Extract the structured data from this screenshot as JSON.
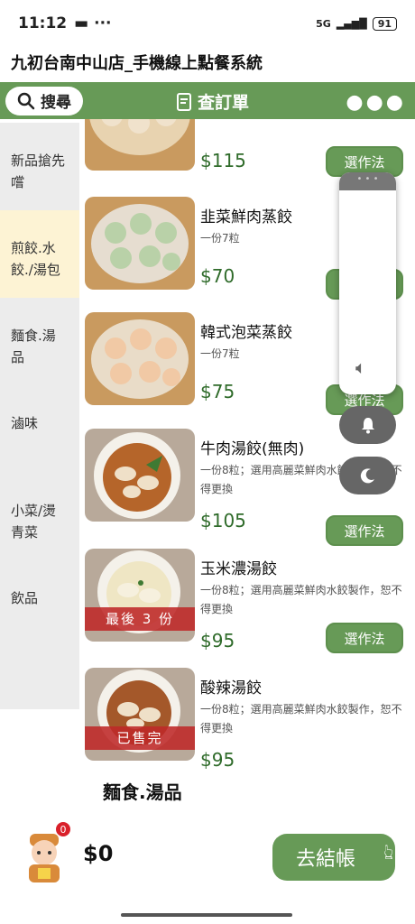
{
  "status_bar": {
    "time": "11:12",
    "network": "5G",
    "battery": "91"
  },
  "app_title": "九初台南中山店_手機線上點餐系統",
  "navbar": {
    "search_label": "搜尋",
    "orders_label": "查訂單"
  },
  "sidebar": {
    "items": [
      {
        "label": "新品搶先嚐"
      },
      {
        "label": "煎餃.水餃./湯包"
      },
      {
        "label": "麵食.湯品"
      },
      {
        "label": "滷味"
      },
      {
        "label": "小菜/燙青菜"
      },
      {
        "label": "飲品"
      }
    ]
  },
  "menu_items": [
    {
      "name": "",
      "desc": "",
      "price": "$115",
      "button": "選作法",
      "ribbon": ""
    },
    {
      "name": "韭菜鮮肉蒸餃",
      "desc": "一份7粒",
      "price": "$70",
      "button": "選作法",
      "ribbon": ""
    },
    {
      "name": "韓式泡菜蒸餃",
      "desc": "一份7粒",
      "price": "$75",
      "button": "選作法",
      "ribbon": ""
    },
    {
      "name": "牛肉湯餃(無肉)",
      "desc": "一份8粒；選用高麗菜鮮肉水餃製作，恕不得更換",
      "price": "$105",
      "button": "選作法",
      "ribbon": ""
    },
    {
      "name": "玉米濃湯餃",
      "desc": "一份8粒；選用高麗菜鮮肉水餃製作，恕不得更換",
      "price": "$95",
      "button": "選作法",
      "ribbon": "最後 3 份"
    },
    {
      "name": "酸辣湯餃",
      "desc": "一份8粒；選用高麗菜鮮肉水餃製作，恕不得更換",
      "price": "$95",
      "button": "",
      "ribbon": "已售完"
    }
  ],
  "section_heading": "麵食.湯品",
  "cart": {
    "badge_count": "0",
    "total": "$0",
    "checkout_label": "去結帳"
  },
  "colors": {
    "brand_green": "#679a57",
    "price_green": "#2f6b2a",
    "ribbon_red": "#be2828"
  }
}
